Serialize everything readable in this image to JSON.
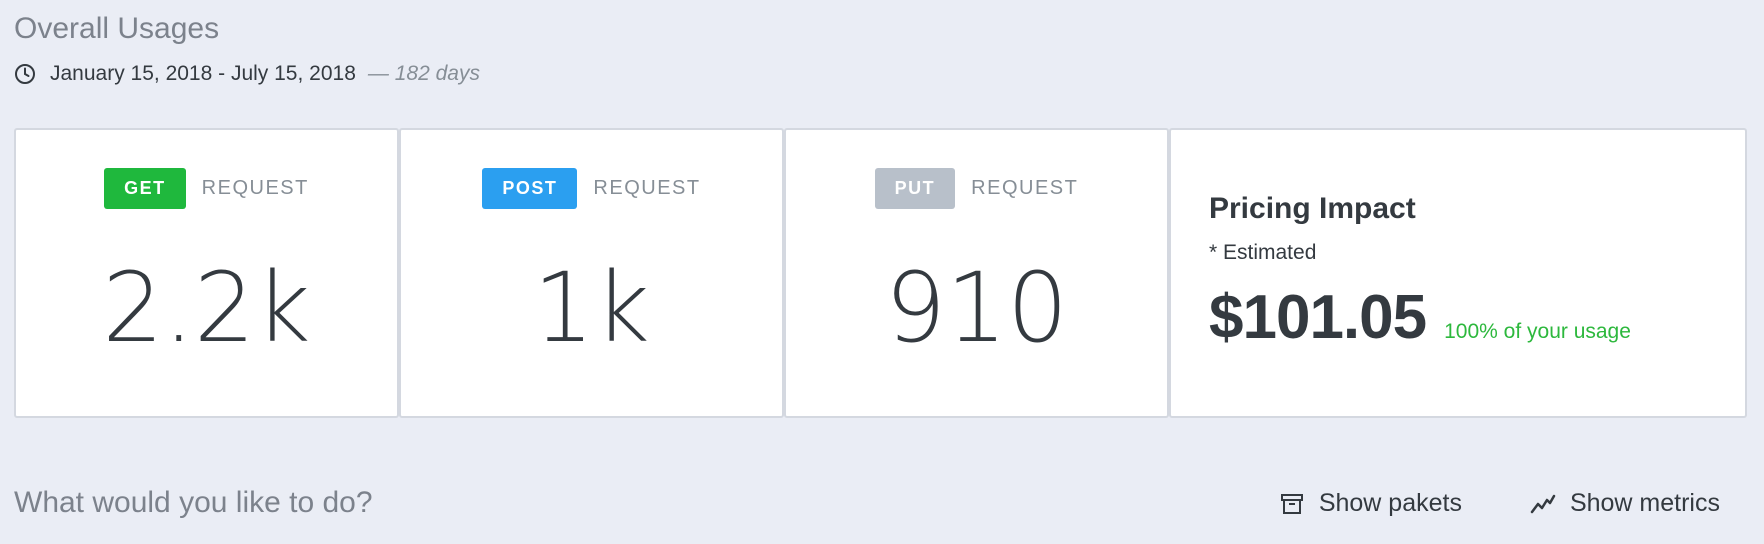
{
  "header": {
    "title": "Overall Usages",
    "date_range": "January 15, 2018 - July 15, 2018",
    "days": "— 182 days",
    "icon": "clock-icon"
  },
  "stats": [
    {
      "method": "GET",
      "label": "REQUEST",
      "value": "2.2k",
      "badge_color": "#1fb83d"
    },
    {
      "method": "POST",
      "label": "REQUEST",
      "value": "1k",
      "badge_color": "#2b9ff0"
    },
    {
      "method": "PUT",
      "label": "REQUEST",
      "value": "910",
      "badge_color": "#b8c0ca"
    }
  ],
  "pricing": {
    "title": "Pricing Impact",
    "note": "* Estimated",
    "amount": "$101.05",
    "percent": "100% of your usage",
    "percent_color": "#2db83d"
  },
  "footer": {
    "question": "What would you like to do?",
    "actions": [
      {
        "label": "Show pakets",
        "icon": "archive-icon"
      },
      {
        "label": "Show metrics",
        "icon": "trend-line-icon"
      }
    ]
  }
}
